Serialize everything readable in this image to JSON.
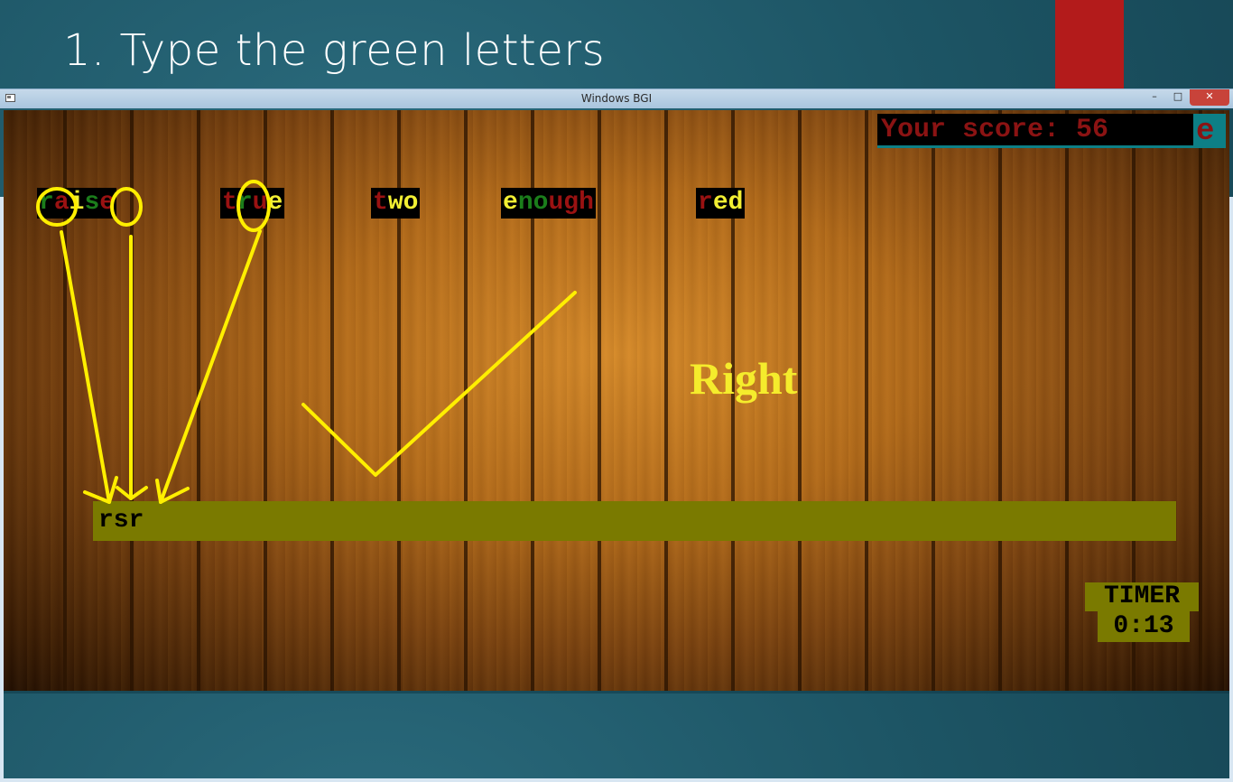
{
  "slide": {
    "title": "1. Type the green letters",
    "accent_color": "#b31b1b"
  },
  "window": {
    "title": "Windows BGI",
    "minimize_label": "–",
    "maximize_label": "□",
    "close_label": "✕"
  },
  "hud": {
    "score_text": "Your score: 56",
    "score_overflow_char": "e",
    "timer_label": "TIMER",
    "timer_value": "0:13"
  },
  "words": [
    {
      "text": "raise",
      "letters": [
        {
          "c": "r",
          "col": "green"
        },
        {
          "c": "a",
          "col": "red"
        },
        {
          "c": "i",
          "col": "yellow"
        },
        {
          "c": "s",
          "col": "green"
        },
        {
          "c": "e",
          "col": "red"
        }
      ]
    },
    {
      "text": "true",
      "letters": [
        {
          "c": "t",
          "col": "red"
        },
        {
          "c": "r",
          "col": "green"
        },
        {
          "c": "u",
          "col": "red"
        },
        {
          "c": "e",
          "col": "yellow"
        }
      ]
    },
    {
      "text": "two",
      "letters": [
        {
          "c": "t",
          "col": "red"
        },
        {
          "c": "w",
          "col": "yellow"
        },
        {
          "c": "o",
          "col": "yellow"
        }
      ]
    },
    {
      "text": "enough",
      "letters": [
        {
          "c": "e",
          "col": "yellow"
        },
        {
          "c": "n",
          "col": "green"
        },
        {
          "c": "o",
          "col": "green"
        },
        {
          "c": "u",
          "col": "red"
        },
        {
          "c": "g",
          "col": "red"
        },
        {
          "c": "h",
          "col": "red"
        }
      ]
    },
    {
      "text": "red",
      "letters": [
        {
          "c": "r",
          "col": "red"
        },
        {
          "c": "e",
          "col": "yellow"
        },
        {
          "c": "d",
          "col": "yellow"
        }
      ]
    }
  ],
  "feedback": "Right",
  "input": {
    "typed": "rsr"
  },
  "colors": {
    "green": "#1b7d1b",
    "red": "#9a1212",
    "yellow": "#f2ef33",
    "bar": "#7a7a00",
    "annotation": "#ffef00"
  },
  "annotations": {
    "circled_letters": [
      "r",
      "s",
      "r"
    ],
    "checkmark": true
  }
}
